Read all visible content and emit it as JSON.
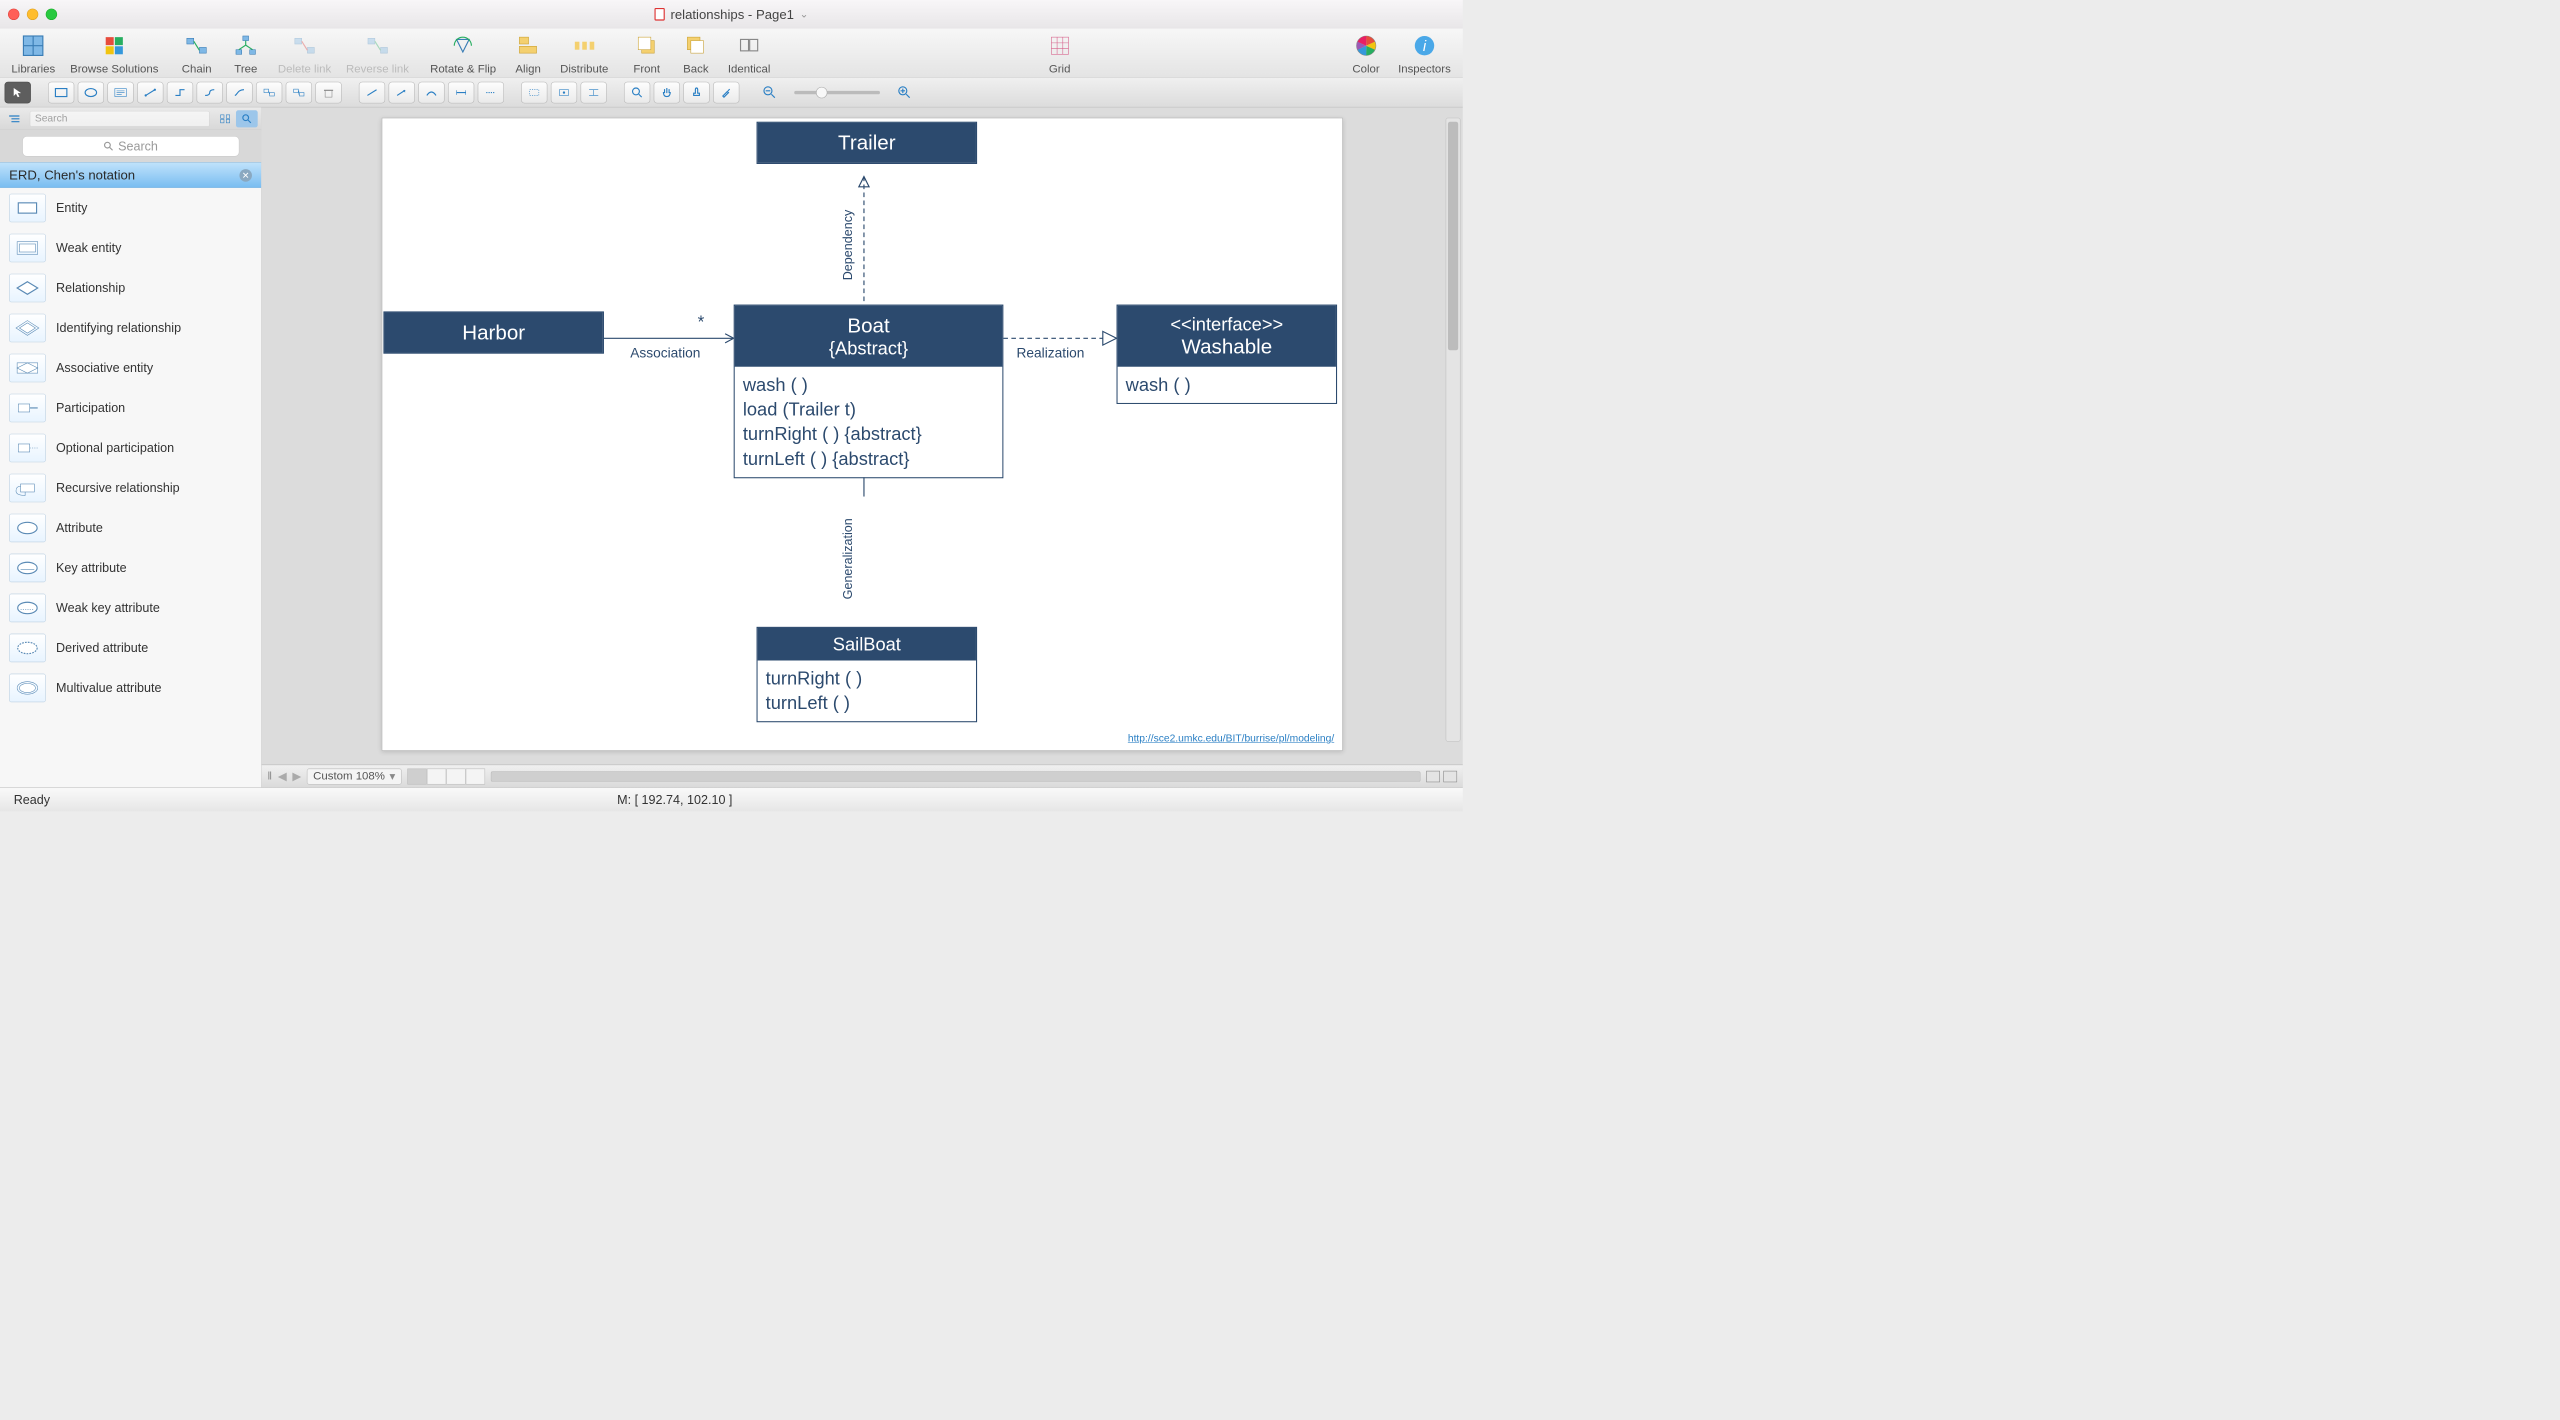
{
  "window": {
    "title": "relationships - Page1"
  },
  "toolbar": {
    "libraries": "Libraries",
    "browse": "Browse Solutions",
    "chain": "Chain",
    "tree": "Tree",
    "deletelink": "Delete link",
    "reverselink": "Reverse link",
    "rotate": "Rotate & Flip",
    "align": "Align",
    "distribute": "Distribute",
    "front": "Front",
    "back": "Back",
    "identical": "Identical",
    "grid": "Grid",
    "color": "Color",
    "inspectors": "Inspectors"
  },
  "sidebar": {
    "search_placeholder": "Search",
    "category": "ERD, Chen's notation",
    "items": [
      {
        "label": "Entity"
      },
      {
        "label": "Weak entity"
      },
      {
        "label": "Relationship"
      },
      {
        "label": "Identifying relationship"
      },
      {
        "label": "Associative entity"
      },
      {
        "label": "Participation"
      },
      {
        "label": "Optional participation"
      },
      {
        "label": "Recursive relationship"
      },
      {
        "label": "Attribute"
      },
      {
        "label": "Key attribute"
      },
      {
        "label": "Weak key attribute"
      },
      {
        "label": "Derived attribute"
      },
      {
        "label": "Multivalue attribute"
      }
    ]
  },
  "diagram": {
    "trailer": "Trailer",
    "harbor": "Harbor",
    "boat_title": "Boat",
    "boat_sub": "{Abstract}",
    "boat_ops": [
      "wash ( )",
      "load (Trailer t)",
      "turnRight ( ) {abstract}",
      "turnLeft ( ) {abstract}"
    ],
    "washable_stereo": "<<interface>>",
    "washable_name": "Washable",
    "washable_ops": [
      "wash ( )"
    ],
    "sailboat": "SailBoat",
    "sailboat_ops": [
      "turnRight ( )",
      "turnLeft ( )"
    ],
    "assoc": "Association",
    "assoc_star": "*",
    "dep": "Dependency",
    "real": "Realization",
    "gen": "Generalization",
    "url": "http://sce2.umkc.edu/BIT/burrise/pl/modeling/"
  },
  "footer": {
    "zoom": "Custom 108%",
    "ready": "Ready",
    "mouse": "M: [ 192.74, 102.10 ]"
  }
}
